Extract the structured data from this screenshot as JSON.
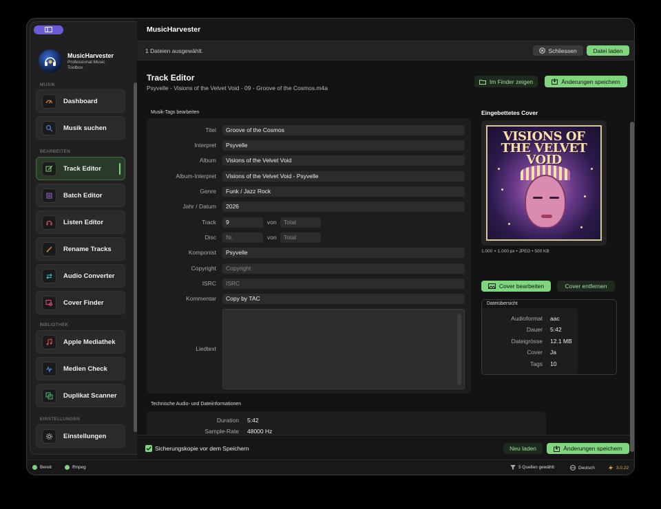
{
  "app": {
    "name": "MusicHarvester",
    "subtitle": "Professional Music Toolbox"
  },
  "sidebar": {
    "sections": [
      "MUSIK",
      "BEARBEITEN",
      "BIBLIOTHEK",
      "EINSTELLUNGEN"
    ],
    "items": [
      {
        "label": "Dashboard",
        "icon": "gauge-icon",
        "color": "#e08a3a"
      },
      {
        "label": "Musik suchen",
        "icon": "magnifier-icon",
        "color": "#4a8ae0"
      },
      {
        "label": "Track Editor",
        "icon": "edit-icon",
        "color": "#7fd67f"
      },
      {
        "label": "Batch Editor",
        "icon": "stack-icon",
        "color": "#a06ae0"
      },
      {
        "label": "Listen Editor",
        "icon": "headphones-icon",
        "color": "#e04a6a"
      },
      {
        "label": "Rename Tracks",
        "icon": "pen-icon",
        "color": "#e08a3a"
      },
      {
        "label": "Audio Converter",
        "icon": "convert-icon",
        "color": "#3ac0c0"
      },
      {
        "label": "Cover Finder",
        "icon": "image-search-icon",
        "color": "#e04a8a"
      },
      {
        "label": "Apple Mediathek",
        "icon": "music-note-icon",
        "color": "#e04a4a"
      },
      {
        "label": "Medien Check",
        "icon": "waveform-icon",
        "color": "#4a8ae0"
      },
      {
        "label": "Duplikat Scanner",
        "icon": "duplicate-icon",
        "color": "#4ac07a"
      },
      {
        "label": "Einstellungen",
        "icon": "gear-icon",
        "color": "#cccccc"
      }
    ]
  },
  "header": {
    "title": "MusicHarvester"
  },
  "infobar": {
    "text": "1 Dateien ausgewählt.",
    "close_label": "Schliessen",
    "load_label": "Datei laden"
  },
  "editor": {
    "title": "Track Editor",
    "filename": "Psyvelle - Visions of the Velvet Void - 09 - Groove of the Cosmos.m4a",
    "finder_label": "Im Finder zeigen",
    "save_label": "Änderungen speichern",
    "tags_heading": "Musik-Tags bearbeiten",
    "fields": {
      "title_label": "Titel",
      "title": "Groove of the Cosmos",
      "artist_label": "Interpret",
      "artist": "Psyvelle",
      "album_label": "Album",
      "album": "Visions of the Velvet Void",
      "album_artist_label": "Album-Interpret",
      "album_artist": "Visions of the Velvet Void - Psyvelle",
      "genre_label": "Genre",
      "genre": "Funk / Jazz Rock",
      "year_label": "Jahr / Datum",
      "year": "2026",
      "track_label": "Track",
      "track": "9",
      "of_label": "von",
      "track_total_ph": "Total",
      "disc_label": "Disc",
      "disc_ph": "Nr.",
      "disc_total_ph": "Total",
      "composer_label": "Komponist",
      "composer": "Psyvelle",
      "copyright_label": "Copyright",
      "copyright_ph": "Copyright",
      "isrc_label": "ISRC",
      "isrc_ph": "ISRC",
      "comment_label": "Kommentar",
      "comment": "Copy by TAC",
      "lyrics_label": "Liedtext"
    },
    "tech_heading": "Technische Audio- und Dateiinformationen",
    "tech": {
      "duration_label": "Duration",
      "duration": "5:42",
      "samplerate_label": "Sample-Rate",
      "samplerate": "48000 Hz"
    }
  },
  "cover": {
    "heading": "Eingebettetes Cover",
    "art_title": "VISIONS OF THE VELVET VOID",
    "info": "1.000 × 1.000 px • JPEG • 500 KB",
    "edit_label": "Cover bearbeiten",
    "remove_label": "Cover entfernen"
  },
  "file_overview": {
    "heading": "Dateiübersicht",
    "rows": [
      {
        "k": "Audioformat",
        "v": "aac"
      },
      {
        "k": "Dauer",
        "v": "5:42"
      },
      {
        "k": "Dateigrösse",
        "v": "12.1 MB"
      },
      {
        "k": "Cover",
        "v": "Ja"
      },
      {
        "k": "Tags",
        "v": "10"
      }
    ]
  },
  "footer": {
    "backup_label": "Sicherungskopie vor dem Speichern",
    "reload_label": "Neu laden",
    "save_label": "Änderungen speichern"
  },
  "status": {
    "ready": "Bereit",
    "ffmpeg": "ffmpeg",
    "sources": "5 Quellen gewählt",
    "language": "Deutsch",
    "version": "3.0.22"
  },
  "colors": {
    "accent": "#7fd67f",
    "toggle": "#6b5bd9"
  }
}
